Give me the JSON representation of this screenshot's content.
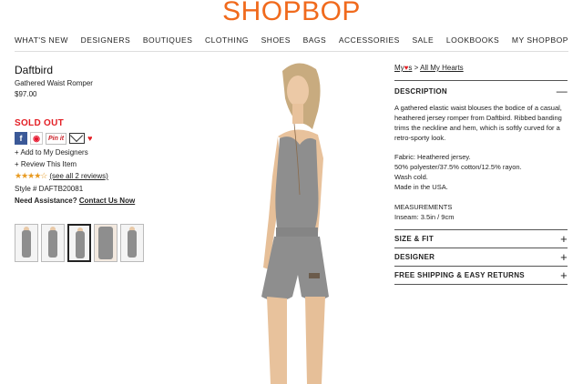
{
  "logo": "SHOPBOP",
  "nav": [
    "WHAT'S NEW",
    "DESIGNERS",
    "BOUTIQUES",
    "CLOTHING",
    "SHOES",
    "BAGS",
    "ACCESSORIES",
    "SALE",
    "LOOKBOOKS",
    "MY SHOPBOP"
  ],
  "product": {
    "brand": "Daftbird",
    "name": "Gathered Waist Romper",
    "price": "$97.00",
    "status": "SOLD OUT"
  },
  "social": {
    "pin_label": "Pin it"
  },
  "links": {
    "add_designers": "+ Add to My Designers",
    "review": "+ Review This Item",
    "stars": "★★★★☆",
    "see_reviews": "(see all 2 reviews)",
    "style": "Style # DAFTB20081",
    "need_assistance": "Need Assistance?",
    "contact": "Contact Us Now"
  },
  "mylinks": {
    "my": "My",
    "s": "s",
    "sep": ">",
    "all": "All My Hearts"
  },
  "description": {
    "title": "DESCRIPTION",
    "toggle": "—",
    "p1": "A gathered elastic waist blouses the bodice of a casual, heathered jersey romper from Daftbird. Ribbed banding trims the neckline and hem, which is softly curved for a retro-sporty look.",
    "fabric": "Fabric: Heathered jersey.",
    "content": "50% polyester/37.5% cotton/12.5% rayon.",
    "care": "Wash cold.",
    "origin": "Made in the USA.",
    "measurements": "MEASUREMENTS",
    "inseam": "Inseam: 3.5in / 9cm"
  },
  "sections": [
    {
      "label": "SIZE & FIT",
      "toggle": "+"
    },
    {
      "label": "DESIGNER",
      "toggle": "+"
    },
    {
      "label": "FREE SHIPPING & EASY RETURNS",
      "toggle": "+"
    }
  ],
  "colors": {
    "brand": "#f06a1d",
    "sold_out": "#e31e24",
    "heather_gray": "#8e8e8e"
  }
}
